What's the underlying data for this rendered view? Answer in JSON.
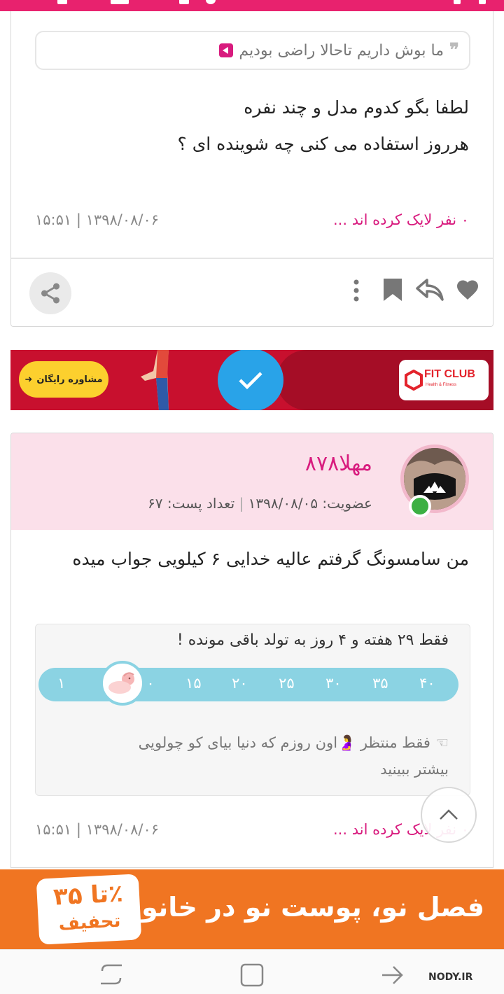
{
  "post1": {
    "quote_text": "ما بوش داریم تاحالا راضی بودیم",
    "body_lines": [
      "لطفا بگو کدوم مدل و چند نفره",
      "هرروز استفاده می کنی چه شوینده ای ؟"
    ],
    "likes": "۰ نفر لایک کرده اند ...",
    "date": "۱۳۹۸/۰۸/۰۶ | ۱۵:۵۱"
  },
  "ad1": {
    "cta": "مشاوره رایگان",
    "brand": "FIT CLUB",
    "brand_sub": "Health & Fitness"
  },
  "post2": {
    "username": "مهلا۸۷۸",
    "membership_label": "عضویت: ۱۳۹۸/۰۸/۰۵",
    "post_count_label": "تعداد پست: ۶۷",
    "body": "من سامسونگ گرفتم عالیه خدایی ۶ کیلویی جواب میده",
    "pregnancy": {
      "title": "فقط ۲۹ هفته و ۴ روز به تولد باقی مونده !",
      "ticks": [
        "۱",
        "۱۰",
        "۱۵",
        "۲۰",
        "۲۵",
        "۳۰",
        "۳۵",
        "۴۰"
      ],
      "current_week": 10.5,
      "footer": "فقط منتظر 🤰اون روزم که دنیا بیای کو چولویی",
      "more": "بیشتر ببینید"
    },
    "likes": "۰ نفر لایک کرده اند ...",
    "date": "۱۳۹۸/۰۸/۰۶ | ۱۵:۵۱"
  },
  "ad2": {
    "badge_top": "تا ۳۵٪",
    "badge_bottom": "تخفیف",
    "headline": "فصل نو، پوست نو در خانومی"
  },
  "watermark": "NODY.IR",
  "colors": {
    "accent": "#d81b7e",
    "status_bar": "#e8226e",
    "header_bg": "#fbe0ea",
    "progress": "#8bd3e3",
    "ad_orange": "#f07522",
    "ad_red": "#c8102e"
  }
}
